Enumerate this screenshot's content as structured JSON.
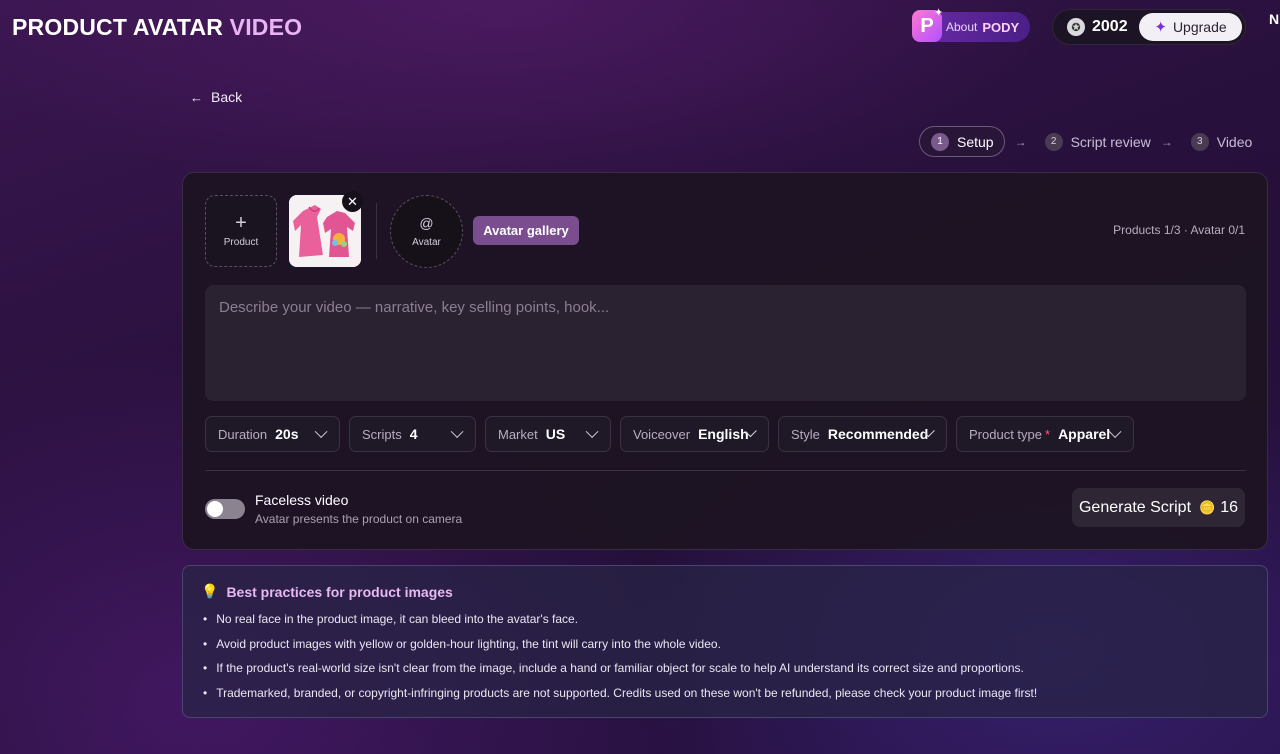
{
  "header": {
    "title_part1": "PRODUCT AVATAR",
    "title_part2": "VIDEO",
    "about_label": "About",
    "about_brand": "PODY",
    "credits": "2002",
    "upgrade_label": "Upgrade",
    "corner_letter": "N"
  },
  "nav": {
    "back_label": "Back"
  },
  "stepper": [
    {
      "num": "1",
      "label": "Setup"
    },
    {
      "num": "2",
      "label": "Script review"
    },
    {
      "num": "3",
      "label": "Video"
    }
  ],
  "setup": {
    "add_product_label": "Product",
    "avatar_label": "Avatar",
    "avatar_gallery_label": "Avatar gallery",
    "counts": "Products 1/3 · Avatar 0/1",
    "description_placeholder": "Describe your video — narrative, key selling points, hook...",
    "description_value": ""
  },
  "options": {
    "duration": {
      "label": "Duration",
      "value": "20s"
    },
    "scripts": {
      "label": "Scripts",
      "value": "4"
    },
    "market": {
      "label": "Market",
      "value": "US"
    },
    "voiceover": {
      "label": "Voiceover",
      "value": "English"
    },
    "style": {
      "label": "Style",
      "value": "Recommended"
    },
    "product_type": {
      "label": "Product type",
      "required_mark": "*",
      "value": "Apparel"
    }
  },
  "faceless": {
    "title": "Faceless video",
    "subtitle": "Avatar presents the product on camera",
    "enabled": false
  },
  "generate": {
    "label": "Generate Script",
    "cost": "16"
  },
  "tips": {
    "title": "Best practices for product images",
    "items": [
      "No real face in the product image, it can bleed into the avatar's face.",
      "Avoid product images with yellow or golden-hour lighting, the tint will carry into the whole video.",
      "If the product's real-world size isn't clear from the image, include a hand or familiar object for scale to help AI understand its correct size and proportions.",
      "Trademarked, branded, or copyright-infringing products are not supported. Credits used on these won't be refunded, please check your product image first!"
    ]
  },
  "colors": {
    "title_accent": "#e9b4f2",
    "gallery_button": "#7a4d8f",
    "required_mark": "#ff5a6e"
  }
}
